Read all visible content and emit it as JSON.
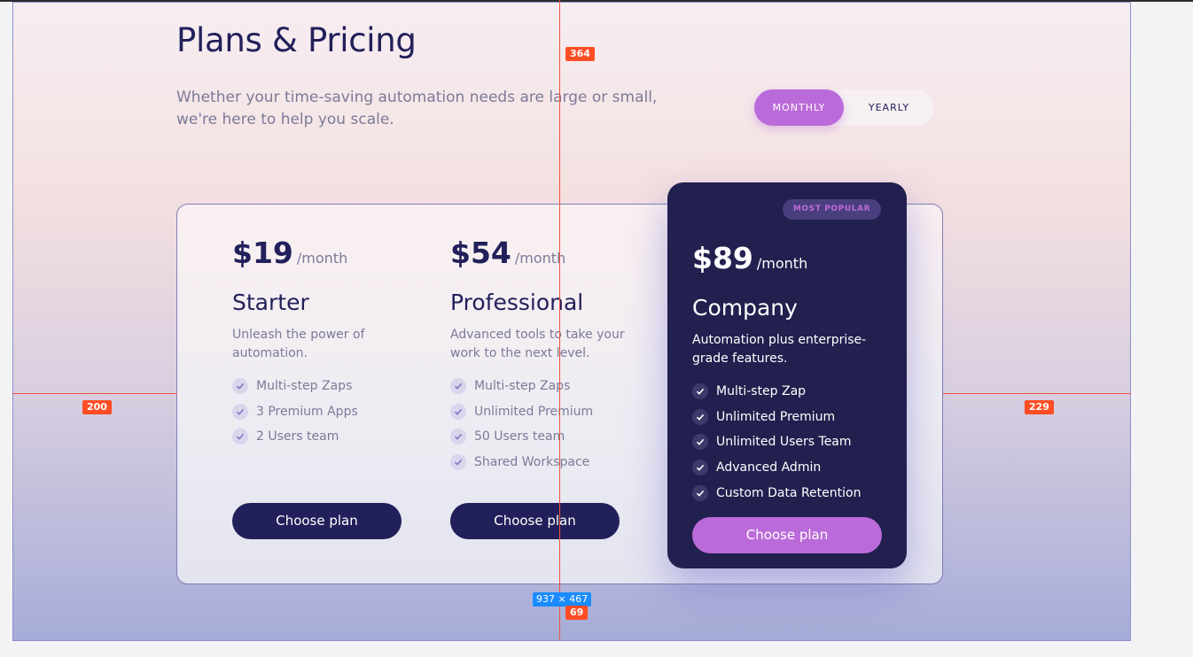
{
  "header": {
    "title": "Plans & Pricing",
    "subtitle": "Whether your time-saving automation needs are large or small, we're here to help you scale."
  },
  "billing_toggle": {
    "monthly_label": "MONTHLY",
    "yearly_label": "YEARLY",
    "selected": "MONTHLY"
  },
  "plans": [
    {
      "price": "$19",
      "period": "/month",
      "name": "Starter",
      "description": "Unleash the power of automation.",
      "features": [
        "Multi-step Zaps",
        "3 Premium Apps",
        "2 Users team"
      ],
      "cta": "Choose plan"
    },
    {
      "price": "$54",
      "period": "/month",
      "name": "Professional",
      "description": "Advanced tools to take your work to the next level.",
      "features": [
        "Multi-step Zaps",
        "Unlimited Premium",
        "50 Users team",
        "Shared Workspace"
      ],
      "cta": "Choose plan"
    },
    {
      "price": "$89",
      "period": "/month",
      "name": "Company",
      "badge": "MOST POPULAR",
      "description": "Automation plus enterprise-grade features.",
      "features": [
        "Multi-step Zap",
        "Unlimited Premium",
        "Unlimited Users Team",
        "Advanced Admin",
        "Custom Data Retention"
      ],
      "cta": "Choose plan"
    }
  ],
  "design_overlay": {
    "spacing_top": "364",
    "spacing_left": "200",
    "spacing_right": "229",
    "spacing_bottom": "69",
    "frame_size": "937 × 467"
  },
  "colors": {
    "primary_dark": "#22205a",
    "accent_purple": "#bb6bd9",
    "muted_text": "#7c7a98",
    "guide_red": "#f0533a",
    "selection_blue": "#1a8cff"
  }
}
